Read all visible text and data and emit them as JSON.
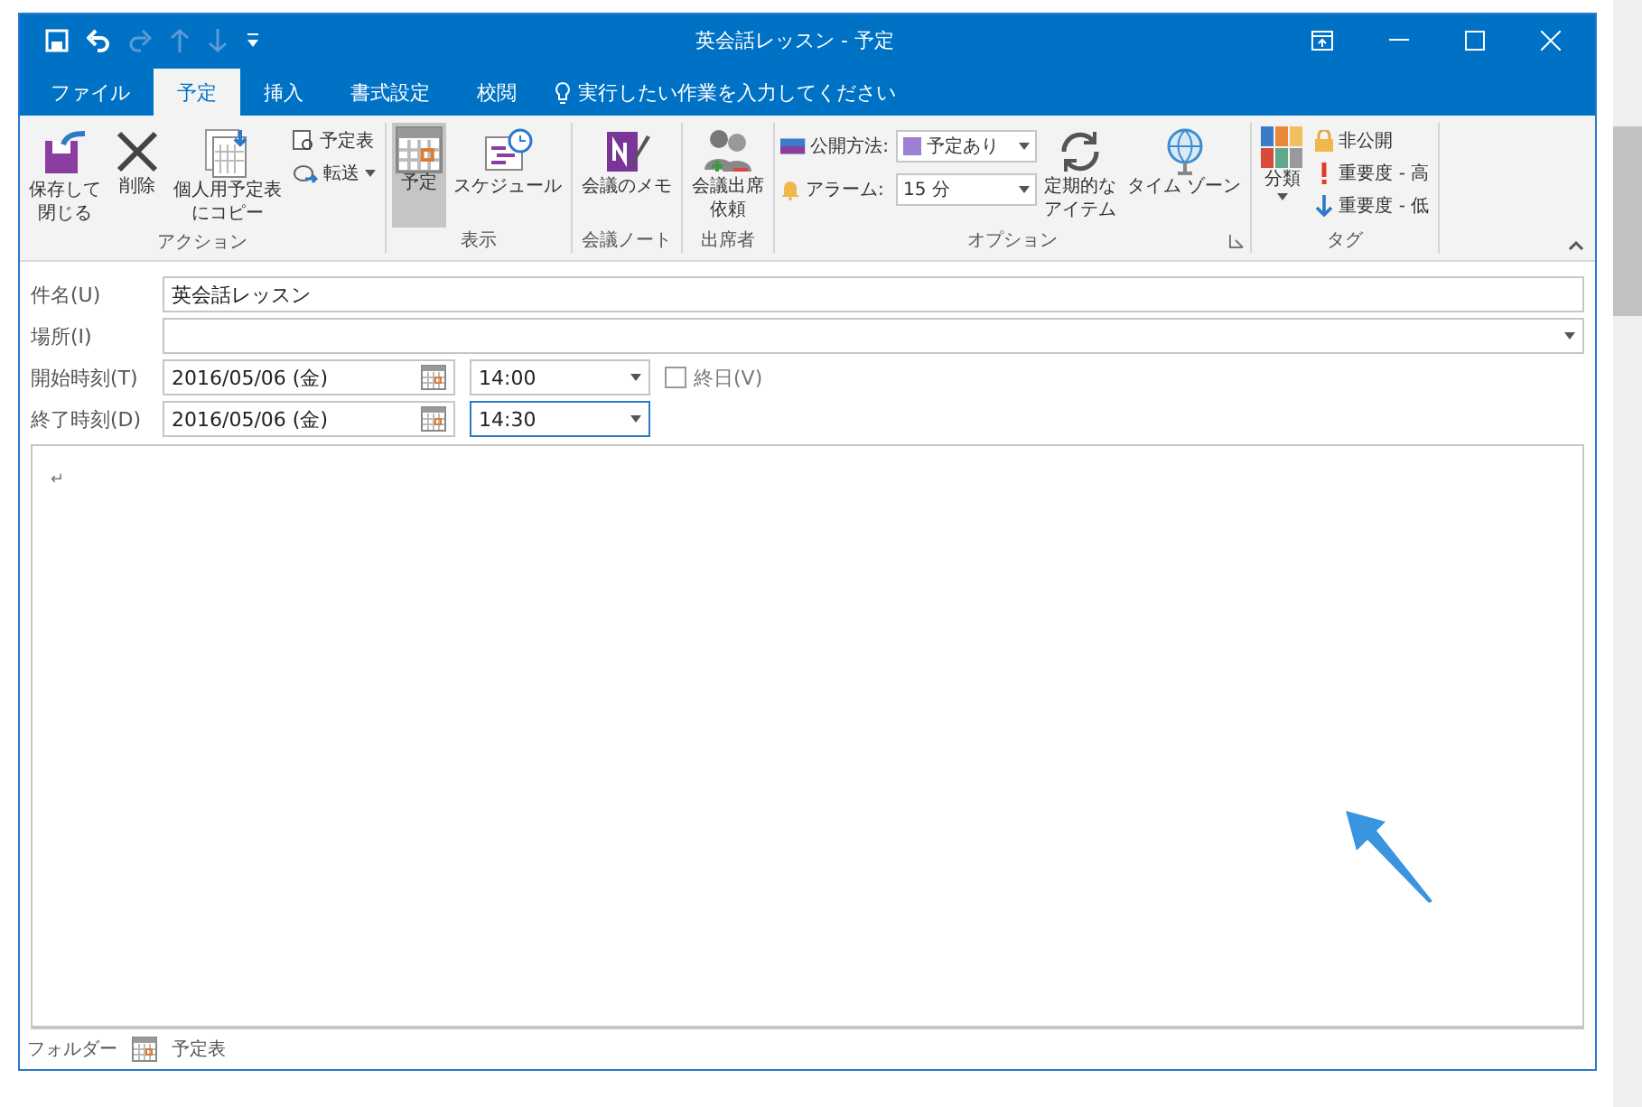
{
  "window": {
    "title": "英会話レッスン - 予定"
  },
  "tabs": [
    {
      "label": "ファイル",
      "selected": false
    },
    {
      "label": "予定",
      "selected": true
    },
    {
      "label": "挿入",
      "selected": false
    },
    {
      "label": "書式設定",
      "selected": false
    },
    {
      "label": "校閲",
      "selected": false
    }
  ],
  "tell_me": "実行したい作業を入力してください",
  "ribbon": {
    "groups": [
      {
        "label": "アクション",
        "large": [
          {
            "lines": [
              "保存して",
              "閉じる"
            ],
            "selected": false
          },
          {
            "lines": [
              "削除"
            ],
            "selected": false
          },
          {
            "lines": [
              "個人用予定表",
              "にコピー"
            ],
            "selected": false
          }
        ],
        "small": [
          {
            "label": "予定表",
            "dropdown": false
          },
          {
            "label": "転送",
            "dropdown": true
          }
        ]
      },
      {
        "label": "表示",
        "large": [
          {
            "lines": [
              "予定"
            ],
            "selected": true
          },
          {
            "lines": [
              "スケジュール"
            ],
            "selected": false
          }
        ]
      },
      {
        "label": "会議ノート",
        "large": [
          {
            "lines": [
              "会議のメモ"
            ],
            "selected": false
          }
        ]
      },
      {
        "label": "出席者",
        "large": [
          {
            "lines": [
              "会議出席",
              "依頼"
            ],
            "selected": false
          }
        ]
      },
      {
        "label": "オプション",
        "fields": [
          {
            "label": "公開方法:",
            "value": "予定あり",
            "color": "#9b7fd4"
          },
          {
            "label": "アラーム:",
            "value": "15 分"
          }
        ],
        "large": [
          {
            "lines": [
              "定期的な",
              "アイテム"
            ],
            "selected": false
          },
          {
            "lines": [
              "タイム ゾーン"
            ],
            "selected": false
          }
        ],
        "launcher": true
      },
      {
        "label": "タグ",
        "large": [
          {
            "lines": [
              "分類"
            ],
            "selected": false,
            "dropdown": true
          }
        ],
        "small": [
          {
            "label": "非公開",
            "dropdown": false
          },
          {
            "label": "重要度 - 高",
            "dropdown": false
          },
          {
            "label": "重要度 - 低",
            "dropdown": false
          }
        ]
      }
    ]
  },
  "form": {
    "subject": {
      "label": "件名(U)",
      "value": "英会話レッスン"
    },
    "location": {
      "label": "場所(I)"
    },
    "start": {
      "label": "開始時刻(T)",
      "date": "2016/05/06 (金)",
      "time": "14:00",
      "focused": false
    },
    "all_day": {
      "label": "終日(V)",
      "checked": false
    },
    "end": {
      "label": "終了時刻(D)",
      "date": "2016/05/06 (金)",
      "time": "14:30",
      "focused": true
    }
  },
  "body": {
    "text": "↵"
  },
  "footer": {
    "label": "フォルダー",
    "folder": "予定表"
  }
}
